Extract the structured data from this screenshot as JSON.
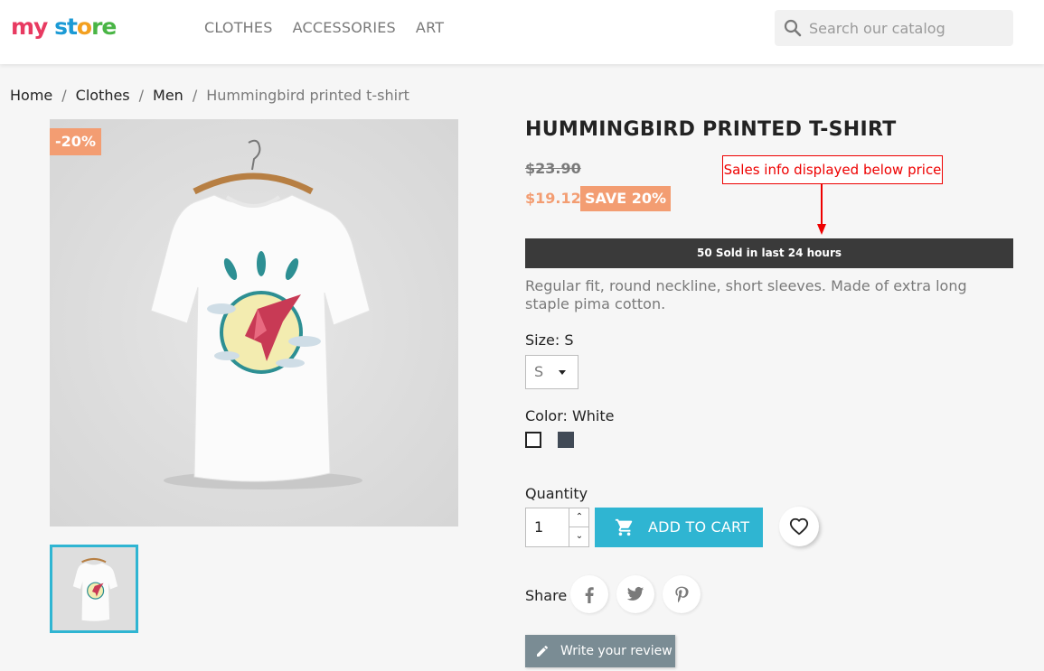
{
  "header": {
    "logo": {
      "part1": "my",
      "part2": " st",
      "part3": "o",
      "part4": "re"
    },
    "nav": [
      "CLOTHES",
      "ACCESSORIES",
      "ART"
    ],
    "search_placeholder": "Search our catalog"
  },
  "breadcrumb": [
    "Home",
    "Clothes",
    "Men",
    "Hummingbird printed t-shirt"
  ],
  "product": {
    "discount_flag": "-20%",
    "title": "HUMMINGBIRD PRINTED T-SHIRT",
    "old_price": "$23.90",
    "price": "$19.12",
    "save_badge": "SAVE 20%",
    "sold_info": "50 Sold in last 24 hours",
    "description": "Regular fit, round neckline, short sleeves. Made of extra long staple pima cotton.",
    "size_label": "Size: S",
    "size_value": "S",
    "color_label": "Color: White",
    "colors": [
      "#ffffff",
      "#414a56"
    ],
    "quantity_label": "Quantity",
    "quantity_value": "1",
    "add_to_cart": "ADD TO CART",
    "share_label": "Share",
    "review_button": "Write your review"
  },
  "annotation": {
    "text": "Sales info displayed below price"
  },
  "colors": {
    "accent": "#2fb5d2",
    "sale": "#f39d72",
    "dark_bar": "#3a3a3a",
    "annotation": "#ee0000"
  }
}
